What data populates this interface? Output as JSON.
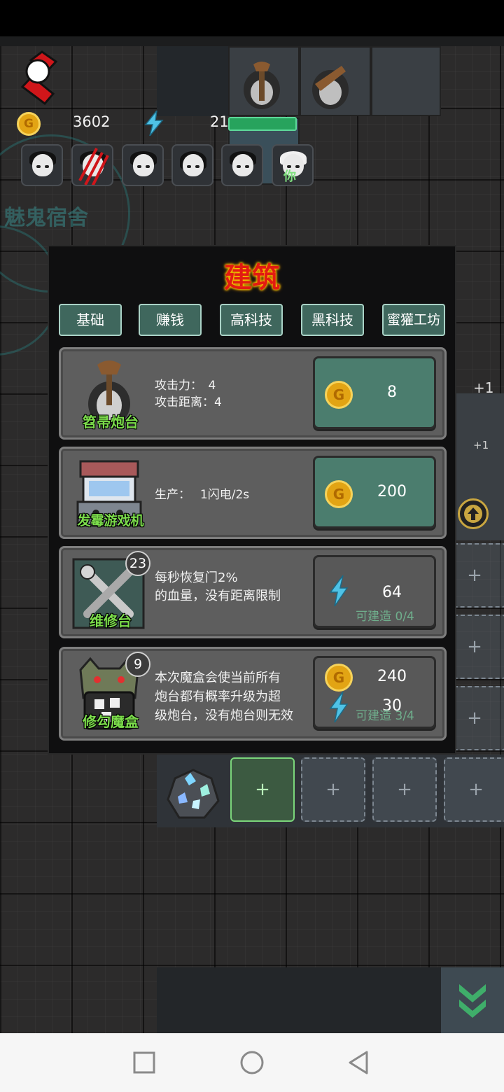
{
  "hud": {
    "gold": "3602",
    "energy": "21",
    "energy_bar_fraction": 1.0,
    "coin_symbol": "G",
    "you_label": "你"
  },
  "map": {
    "sign_text": "魅鬼宿舍",
    "income_label": "+1",
    "income_label2": "+1",
    "plus": "+"
  },
  "dialog": {
    "title": "建筑",
    "tabs": [
      {
        "label": "基础"
      },
      {
        "label": "赚钱"
      },
      {
        "label": "高科技"
      },
      {
        "label": "黑科技"
      },
      {
        "label": "蜜獾工坊"
      }
    ],
    "buildings": [
      {
        "name": "笤帚炮台",
        "desc_line1": "攻击力：　4",
        "desc_line2": "攻击距离：4",
        "cost_gold": "8"
      },
      {
        "name": "发霉游戏机",
        "desc_line1": "生产：　 1闪电/2s",
        "cost_gold": "200"
      },
      {
        "name": "维修台",
        "badge": "23",
        "desc_line1": "每秒恢复门2%",
        "desc_line2": "的血量，没有距离限制",
        "cost_energy": "64",
        "status": "可建造 0/4"
      },
      {
        "name": "修勾魔盒",
        "badge": "9",
        "desc_line1": "本次魔盒会使当前所有",
        "desc_line2": "炮台都有概率升级为超",
        "desc_line3": "级炮台，没有炮台则无效",
        "cost_gold": "240",
        "cost_energy": "30",
        "status": "可建造 3/4"
      }
    ]
  },
  "colors": {
    "title_red": "#e21b12",
    "tab_bg": "#3f675d",
    "price_active": "#4b7d6e",
    "name_green": "#7bdc4b",
    "energy_bar": "#1e8a4c"
  }
}
